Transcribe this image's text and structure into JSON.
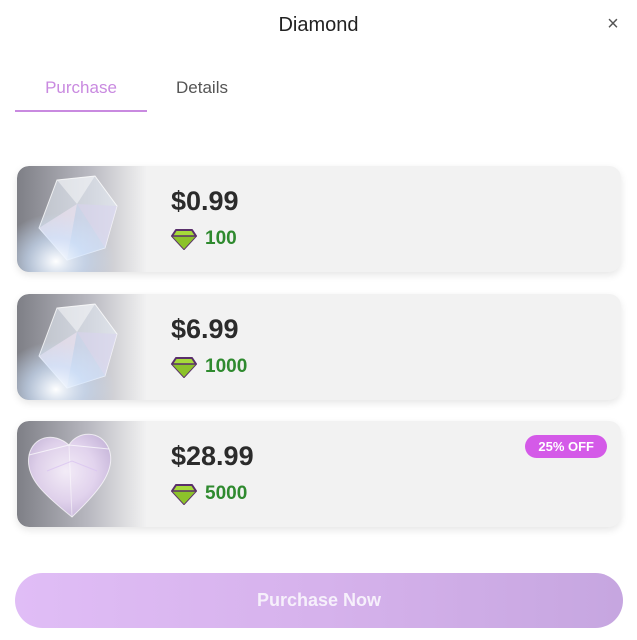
{
  "header": {
    "title": "Diamond",
    "close_glyph": "×"
  },
  "tabs": [
    {
      "label": "Purchase",
      "active": true
    },
    {
      "label": "Details",
      "active": false
    }
  ],
  "offers": [
    {
      "price": "$0.99",
      "amount": "100",
      "image": "crystal-gem-image",
      "badge": ""
    },
    {
      "price": "$6.99",
      "amount": "1000",
      "image": "crystal-gem-image",
      "badge": ""
    },
    {
      "price": "$28.99",
      "amount": "5000",
      "image": "heart-crystal-image",
      "badge": "25% OFF"
    }
  ],
  "purchase_button": {
    "label": "Purchase Now"
  },
  "colors": {
    "accent": "#c98ae0",
    "badge": "#d45ae8",
    "amount": "#2f8a2f",
    "diamond_icon_fill": "#a6d93a",
    "diamond_icon_stroke": "#5a2f6b"
  },
  "icons": {
    "diamond": "diamond-icon",
    "close": "close-icon"
  }
}
